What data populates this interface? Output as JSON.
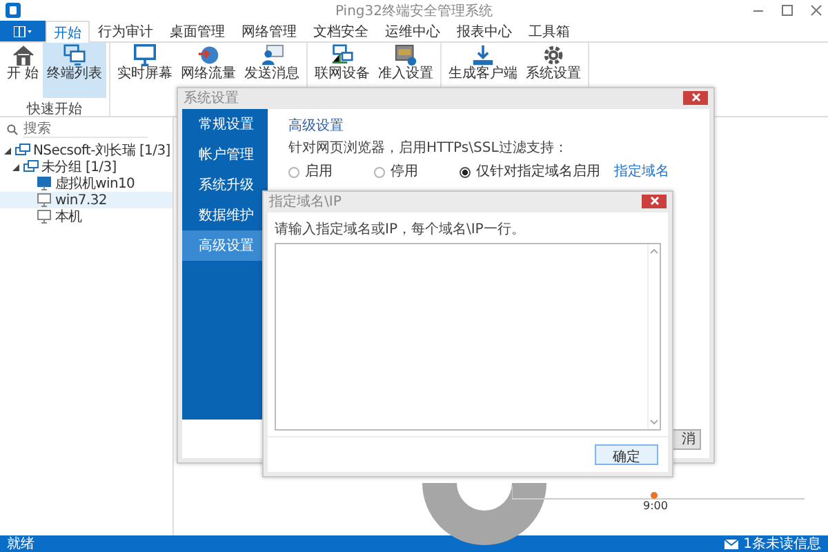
{
  "window": {
    "title": "Ping32终端安全管理系统"
  },
  "menu_tabs": [
    {
      "label": "开始",
      "selected": true
    },
    {
      "label": "行为审计",
      "selected": false
    },
    {
      "label": "桌面管理",
      "selected": false
    },
    {
      "label": "网络管理",
      "selected": false
    },
    {
      "label": "文档安全",
      "selected": false
    },
    {
      "label": "运维中心",
      "selected": false
    },
    {
      "label": "报表中心",
      "selected": false
    },
    {
      "label": "工具箱",
      "selected": false
    }
  ],
  "ribbon_groups": [
    {
      "label": "快速开始",
      "buttons": [
        {
          "label": "开 始",
          "selected": false
        },
        {
          "label": "终端列表",
          "selected": true
        }
      ]
    },
    {
      "buttons": [
        {
          "label": "实时屏幕",
          "selected": false
        },
        {
          "label": "网络流量",
          "selected": false
        },
        {
          "label": "发送消息",
          "selected": false
        }
      ]
    },
    {
      "buttons": [
        {
          "label": "联网设备",
          "selected": false
        },
        {
          "label": "准入设置",
          "selected": false
        }
      ]
    },
    {
      "buttons": [
        {
          "label": "生成客户端",
          "selected": false
        },
        {
          "label": "系统设置",
          "selected": false
        }
      ]
    }
  ],
  "sidebar": {
    "search": {
      "placeholder": "搜索"
    },
    "tree": [
      {
        "label": "NSecsoft-刘长瑞 [1/3]",
        "expanded": true,
        "selected": false,
        "children": [
          {
            "label": "未分组 [1/3]",
            "expanded": true,
            "selected": false,
            "children": [
              {
                "label": "虚拟机win10",
                "online": true,
                "selected": false
              },
              {
                "label": "win7.32",
                "online": false,
                "selected": true
              },
              {
                "label": "本机",
                "online": false,
                "selected": false
              }
            ]
          }
        ]
      }
    ]
  },
  "dashboard": {
    "chart_axis_label": "9:00"
  },
  "settings_dialog": {
    "title": "系统设置",
    "nav": [
      {
        "label": "常规设置",
        "selected": false
      },
      {
        "label": "帐户管理",
        "selected": false
      },
      {
        "label": "系统升级",
        "selected": false
      },
      {
        "label": "数据维护",
        "selected": false
      },
      {
        "label": "高级设置",
        "selected": true
      }
    ],
    "section_title": "高级设置",
    "https_label": "针对网页浏览器，启用HTTPs\\SSL过滤支持：",
    "radios": [
      {
        "label": "启用",
        "selected": false
      },
      {
        "label": "停用",
        "selected": false
      },
      {
        "label": "仅针对指定域名启用",
        "selected": true
      }
    ],
    "domain_link": "指定域名",
    "button": "消"
  },
  "domain_dialog": {
    "title": "指定域名\\IP",
    "instruction": "请输入指定域名或IP，每个域名\\IP一行。",
    "button": "确定"
  },
  "status_bar": {
    "text": "就绪",
    "messages": "1条未读信息"
  }
}
